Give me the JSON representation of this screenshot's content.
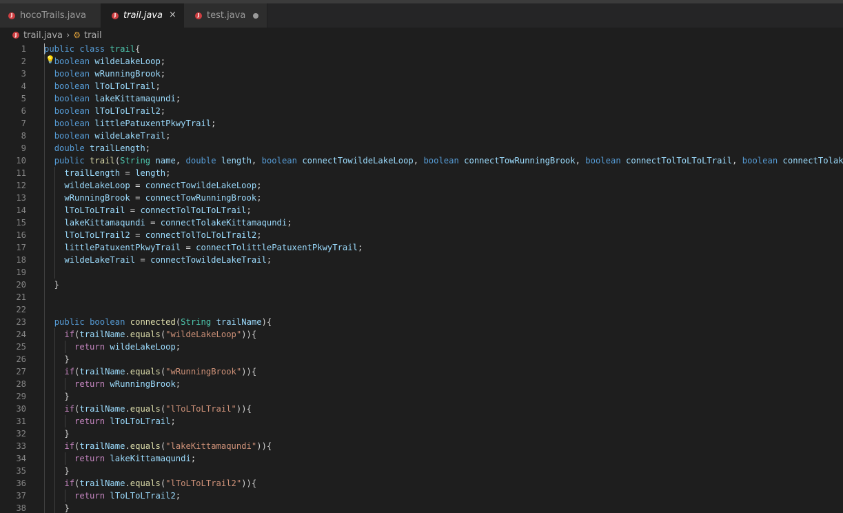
{
  "tabs": [
    {
      "label": "hocoTrails.java",
      "icon": "java-file-icon",
      "active": false
    },
    {
      "label": "trail.java",
      "icon": "java-file-icon",
      "active": true,
      "close": "×"
    },
    {
      "label": "test.java",
      "icon": "java-file-icon",
      "active": false,
      "dirty": true
    }
  ],
  "breadcrumb": {
    "file": "trail.java",
    "separator": "›",
    "symbol": "trail"
  },
  "colors": {
    "background": "#1e1e1e",
    "keyword": "#569cd6",
    "type": "#4ec9b0",
    "variable": "#9cdcfe",
    "function": "#dcdcaa",
    "string": "#ce9178",
    "control": "#c586c0",
    "line_number": "#858585"
  },
  "editor": {
    "lines": [
      {
        "n": "1",
        "t": [
          [
            "kw",
            "public"
          ],
          [
            "p",
            " "
          ],
          [
            "kw",
            "class"
          ],
          [
            "p",
            " "
          ],
          [
            "ty",
            "trail"
          ],
          [
            "p",
            "{"
          ]
        ]
      },
      {
        "n": "2",
        "t": [
          [
            "p",
            "  "
          ],
          [
            "kw",
            "boolean"
          ],
          [
            "p",
            " "
          ],
          [
            "va",
            "wildeLakeLoop"
          ],
          [
            "p",
            ";"
          ]
        ]
      },
      {
        "n": "3",
        "t": [
          [
            "p",
            "  "
          ],
          [
            "kw",
            "boolean"
          ],
          [
            "p",
            " "
          ],
          [
            "va",
            "wRunningBrook"
          ],
          [
            "p",
            ";"
          ]
        ]
      },
      {
        "n": "4",
        "t": [
          [
            "p",
            "  "
          ],
          [
            "kw",
            "boolean"
          ],
          [
            "p",
            " "
          ],
          [
            "va",
            "lToLToLTrail"
          ],
          [
            "p",
            ";"
          ]
        ]
      },
      {
        "n": "5",
        "t": [
          [
            "p",
            "  "
          ],
          [
            "kw",
            "boolean"
          ],
          [
            "p",
            " "
          ],
          [
            "va",
            "lakeKittamaqundi"
          ],
          [
            "p",
            ";"
          ]
        ]
      },
      {
        "n": "6",
        "t": [
          [
            "p",
            "  "
          ],
          [
            "kw",
            "boolean"
          ],
          [
            "p",
            " "
          ],
          [
            "va",
            "lToLToLTrail2"
          ],
          [
            "p",
            ";"
          ]
        ]
      },
      {
        "n": "7",
        "t": [
          [
            "p",
            "  "
          ],
          [
            "kw",
            "boolean"
          ],
          [
            "p",
            " "
          ],
          [
            "va",
            "littlePatuxentPkwyTrail"
          ],
          [
            "p",
            ";"
          ]
        ]
      },
      {
        "n": "8",
        "t": [
          [
            "p",
            "  "
          ],
          [
            "kw",
            "boolean"
          ],
          [
            "p",
            " "
          ],
          [
            "va",
            "wildeLakeTrail"
          ],
          [
            "p",
            ";"
          ]
        ]
      },
      {
        "n": "9",
        "t": [
          [
            "p",
            "  "
          ],
          [
            "kw",
            "double"
          ],
          [
            "p",
            " "
          ],
          [
            "va",
            "trailLength"
          ],
          [
            "p",
            ";"
          ]
        ]
      },
      {
        "n": "10",
        "t": [
          [
            "p",
            "  "
          ],
          [
            "kw",
            "public"
          ],
          [
            "p",
            " "
          ],
          [
            "fn",
            "trail"
          ],
          [
            "p",
            "("
          ],
          [
            "ty",
            "String"
          ],
          [
            "p",
            " "
          ],
          [
            "va",
            "name"
          ],
          [
            "p",
            ", "
          ],
          [
            "kw",
            "double"
          ],
          [
            "p",
            " "
          ],
          [
            "va",
            "length"
          ],
          [
            "p",
            ", "
          ],
          [
            "kw",
            "boolean"
          ],
          [
            "p",
            " "
          ],
          [
            "va",
            "connectTowildeLakeLoop"
          ],
          [
            "p",
            ", "
          ],
          [
            "kw",
            "boolean"
          ],
          [
            "p",
            " "
          ],
          [
            "va",
            "connectTowRunningBrook"
          ],
          [
            "p",
            ", "
          ],
          [
            "kw",
            "boolean"
          ],
          [
            "p",
            " "
          ],
          [
            "va",
            "connectTolToLToLTrail"
          ],
          [
            "p",
            ", "
          ],
          [
            "kw",
            "boolean"
          ],
          [
            "p",
            " "
          ],
          [
            "va",
            "connectTolakeKi"
          ]
        ]
      },
      {
        "n": "11",
        "t": [
          [
            "p",
            "    "
          ],
          [
            "va",
            "trailLength"
          ],
          [
            "p",
            " = "
          ],
          [
            "va",
            "length"
          ],
          [
            "p",
            ";"
          ]
        ]
      },
      {
        "n": "12",
        "t": [
          [
            "p",
            "    "
          ],
          [
            "va",
            "wildeLakeLoop"
          ],
          [
            "p",
            " = "
          ],
          [
            "va",
            "connectTowildeLakeLoop"
          ],
          [
            "p",
            ";"
          ]
        ]
      },
      {
        "n": "13",
        "t": [
          [
            "p",
            "    "
          ],
          [
            "va",
            "wRunningBrook"
          ],
          [
            "p",
            " = "
          ],
          [
            "va",
            "connectTowRunningBrook"
          ],
          [
            "p",
            ";"
          ]
        ]
      },
      {
        "n": "14",
        "t": [
          [
            "p",
            "    "
          ],
          [
            "va",
            "lToLToLTrail"
          ],
          [
            "p",
            " = "
          ],
          [
            "va",
            "connectTolToLToLTrail"
          ],
          [
            "p",
            ";"
          ]
        ]
      },
      {
        "n": "15",
        "t": [
          [
            "p",
            "    "
          ],
          [
            "va",
            "lakeKittamaqundi"
          ],
          [
            "p",
            " = "
          ],
          [
            "va",
            "connectTolakeKittamaqundi"
          ],
          [
            "p",
            ";"
          ]
        ]
      },
      {
        "n": "16",
        "t": [
          [
            "p",
            "    "
          ],
          [
            "va",
            "lToLToLTrail2"
          ],
          [
            "p",
            " = "
          ],
          [
            "va",
            "connectTolToLToLTrail2"
          ],
          [
            "p",
            ";"
          ]
        ]
      },
      {
        "n": "17",
        "t": [
          [
            "p",
            "    "
          ],
          [
            "va",
            "littlePatuxentPkwyTrail"
          ],
          [
            "p",
            " = "
          ],
          [
            "va",
            "connectTolittlePatuxentPkwyTrail"
          ],
          [
            "p",
            ";"
          ]
        ]
      },
      {
        "n": "18",
        "t": [
          [
            "p",
            "    "
          ],
          [
            "va",
            "wildeLakeTrail"
          ],
          [
            "p",
            " = "
          ],
          [
            "va",
            "connectTowildeLakeTrail"
          ],
          [
            "p",
            ";"
          ]
        ]
      },
      {
        "n": "19",
        "t": []
      },
      {
        "n": "20",
        "t": [
          [
            "p",
            "  }"
          ]
        ]
      },
      {
        "n": "21",
        "t": []
      },
      {
        "n": "22",
        "t": []
      },
      {
        "n": "23",
        "t": [
          [
            "p",
            "  "
          ],
          [
            "kw",
            "public"
          ],
          [
            "p",
            " "
          ],
          [
            "kw",
            "boolean"
          ],
          [
            "p",
            " "
          ],
          [
            "fn",
            "connected"
          ],
          [
            "p",
            "("
          ],
          [
            "ty",
            "String"
          ],
          [
            "p",
            " "
          ],
          [
            "va",
            "trailName"
          ],
          [
            "p",
            "){"
          ]
        ]
      },
      {
        "n": "24",
        "t": [
          [
            "p",
            "    "
          ],
          [
            "cf",
            "if"
          ],
          [
            "p",
            "("
          ],
          [
            "va",
            "trailName"
          ],
          [
            "p",
            "."
          ],
          [
            "fn",
            "equals"
          ],
          [
            "p",
            "("
          ],
          [
            "st",
            "\"wildeLakeLoop\""
          ],
          [
            "p",
            ")){"
          ]
        ]
      },
      {
        "n": "25",
        "t": [
          [
            "p",
            "      "
          ],
          [
            "cf",
            "return"
          ],
          [
            "p",
            " "
          ],
          [
            "va",
            "wildeLakeLoop"
          ],
          [
            "p",
            ";"
          ]
        ]
      },
      {
        "n": "26",
        "t": [
          [
            "p",
            "    }"
          ]
        ]
      },
      {
        "n": "27",
        "t": [
          [
            "p",
            "    "
          ],
          [
            "cf",
            "if"
          ],
          [
            "p",
            "("
          ],
          [
            "va",
            "trailName"
          ],
          [
            "p",
            "."
          ],
          [
            "fn",
            "equals"
          ],
          [
            "p",
            "("
          ],
          [
            "st",
            "\"wRunningBrook\""
          ],
          [
            "p",
            ")){"
          ]
        ]
      },
      {
        "n": "28",
        "t": [
          [
            "p",
            "      "
          ],
          [
            "cf",
            "return"
          ],
          [
            "p",
            " "
          ],
          [
            "va",
            "wRunningBrook"
          ],
          [
            "p",
            ";"
          ]
        ]
      },
      {
        "n": "29",
        "t": [
          [
            "p",
            "    }"
          ]
        ]
      },
      {
        "n": "30",
        "t": [
          [
            "p",
            "    "
          ],
          [
            "cf",
            "if"
          ],
          [
            "p",
            "("
          ],
          [
            "va",
            "trailName"
          ],
          [
            "p",
            "."
          ],
          [
            "fn",
            "equals"
          ],
          [
            "p",
            "("
          ],
          [
            "st",
            "\"lToLToLTrail\""
          ],
          [
            "p",
            ")){"
          ]
        ]
      },
      {
        "n": "31",
        "t": [
          [
            "p",
            "      "
          ],
          [
            "cf",
            "return"
          ],
          [
            "p",
            " "
          ],
          [
            "va",
            "lToLToLTrail"
          ],
          [
            "p",
            ";"
          ]
        ]
      },
      {
        "n": "32",
        "t": [
          [
            "p",
            "    }"
          ]
        ]
      },
      {
        "n": "33",
        "t": [
          [
            "p",
            "    "
          ],
          [
            "cf",
            "if"
          ],
          [
            "p",
            "("
          ],
          [
            "va",
            "trailName"
          ],
          [
            "p",
            "."
          ],
          [
            "fn",
            "equals"
          ],
          [
            "p",
            "("
          ],
          [
            "st",
            "\"lakeKittamaqundi\""
          ],
          [
            "p",
            ")){"
          ]
        ]
      },
      {
        "n": "34",
        "t": [
          [
            "p",
            "      "
          ],
          [
            "cf",
            "return"
          ],
          [
            "p",
            " "
          ],
          [
            "va",
            "lakeKittamaqundi"
          ],
          [
            "p",
            ";"
          ]
        ]
      },
      {
        "n": "35",
        "t": [
          [
            "p",
            "    }"
          ]
        ]
      },
      {
        "n": "36",
        "t": [
          [
            "p",
            "    "
          ],
          [
            "cf",
            "if"
          ],
          [
            "p",
            "("
          ],
          [
            "va",
            "trailName"
          ],
          [
            "p",
            "."
          ],
          [
            "fn",
            "equals"
          ],
          [
            "p",
            "("
          ],
          [
            "st",
            "\"lToLToLTrail2\""
          ],
          [
            "p",
            ")){"
          ]
        ]
      },
      {
        "n": "37",
        "t": [
          [
            "p",
            "      "
          ],
          [
            "cf",
            "return"
          ],
          [
            "p",
            " "
          ],
          [
            "va",
            "lToLToLTrail2"
          ],
          [
            "p",
            ";"
          ]
        ]
      },
      {
        "n": "38",
        "t": [
          [
            "p",
            "    }"
          ]
        ]
      }
    ]
  }
}
